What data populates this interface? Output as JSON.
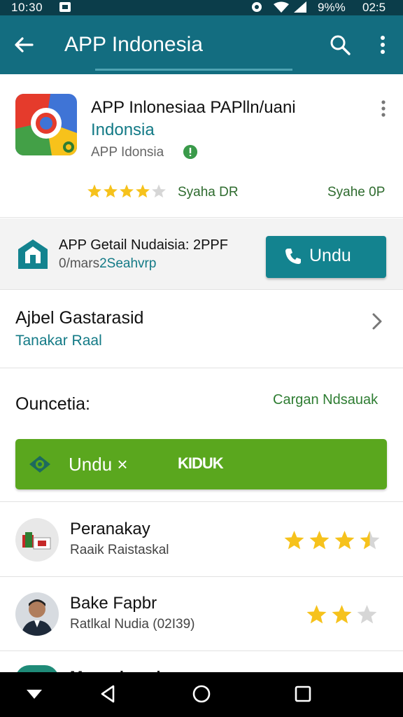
{
  "status_bar": {
    "time": "10:30",
    "battery": "9%%",
    "clock_right": "02:5"
  },
  "app_bar": {
    "title": "APP Indonesia"
  },
  "app_header": {
    "name": "APP Inlonesiaa PAPlln/uani",
    "subtitle": "Indonsia",
    "developer": "APP Idonsia",
    "rating_stars": 4,
    "rating_label": "Syaha DR",
    "rating_label_right": "Syahe 0P"
  },
  "install_row": {
    "title": "APP Getail Nudaisia: 2PPF",
    "sub_grey": "0/mars",
    "sub_teal": "2Seahvrp",
    "button_label": "Undu"
  },
  "detail_row": {
    "title": "Ajbel Gastarasid",
    "subtitle": "Tanakar Raal"
  },
  "description": {
    "title": "Ouncetia:",
    "link": "Cargan Ndsauak",
    "button_label": "Undu ×",
    "button_label2": "KIDUK"
  },
  "reviews": [
    {
      "name": "Peranakay",
      "subtitle": "Raaik Raistaskal",
      "stars": 3.5
    },
    {
      "name": "Bake Fapbr",
      "subtitle": "Ratlkal Nudia (02I39)",
      "stars": 2
    }
  ],
  "peek_review": {
    "name": "Mapoobamdu"
  },
  "colors": {
    "app_bar": "#136d80",
    "teal_button": "#13838f",
    "green_button": "#5aa71e",
    "star": "#f6c21c"
  }
}
